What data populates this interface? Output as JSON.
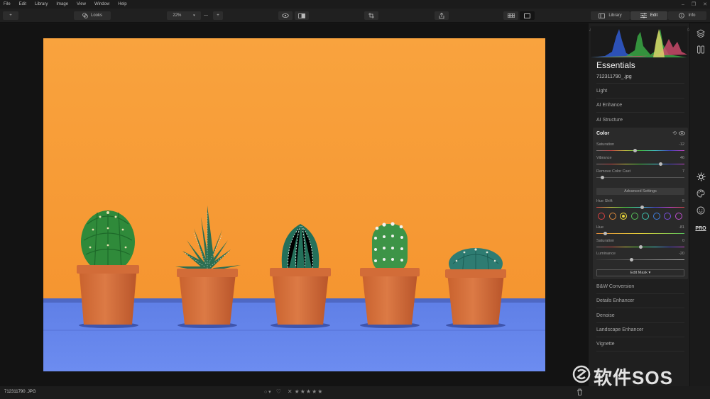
{
  "menu": [
    "File",
    "Edit",
    "Library",
    "Image",
    "View",
    "Window",
    "Help"
  ],
  "window_controls": [
    "–",
    "❐",
    "✕"
  ],
  "toolbar": {
    "add": "+",
    "looks_label": "Looks",
    "zoom_value": "22%",
    "zoom_minus": "—",
    "zoom_plus": "+",
    "tab_library": "Library",
    "tab_edit": "Edit",
    "tab_info": "Info"
  },
  "panel": {
    "title": "Essentials",
    "filename": "712311790_.jpg",
    "sections_top": [
      "Light",
      "AI Enhance",
      "AI Structure"
    ],
    "color": {
      "title": "Color",
      "sliders": [
        {
          "label": "Saturation",
          "value": "-12",
          "level": 0.44
        },
        {
          "label": "Vibrance",
          "value": "46",
          "level": 0.73
        },
        {
          "label": "Remove Color Cast",
          "value": "7",
          "level": 0.07
        }
      ],
      "advanced_label": "Advanced Settings",
      "hue_shift": {
        "label": "Hue Shift",
        "value": "5",
        "level": 0.52
      },
      "hue_dots": [
        "#d94040",
        "#e08a3a",
        "#e7d23a",
        "#57c25a",
        "#3fc3b0",
        "#3f7fe0",
        "#7a4fe0",
        "#c04fd0"
      ],
      "selected_dot_index": 2,
      "adv_sliders": [
        {
          "label": "Hue",
          "value": "-81",
          "level": 0.1
        },
        {
          "label": "Saturation",
          "value": "0",
          "level": 0.5
        },
        {
          "label": "Luminance",
          "value": "-20",
          "level": 0.4
        }
      ],
      "edit_mask_label": "Edit Mask ▾"
    },
    "sections_bottom": [
      "B&W Conversion",
      "Details Enhancer",
      "Denoise",
      "Landscape Enhancer",
      "Vignette"
    ]
  },
  "right_strip": {
    "pro_label": "PRO"
  },
  "bottom": {
    "filename": "712311790 .JPG",
    "rating_stars": "★★★★★",
    "reject": "✕"
  },
  "watermark": "软件SOS"
}
